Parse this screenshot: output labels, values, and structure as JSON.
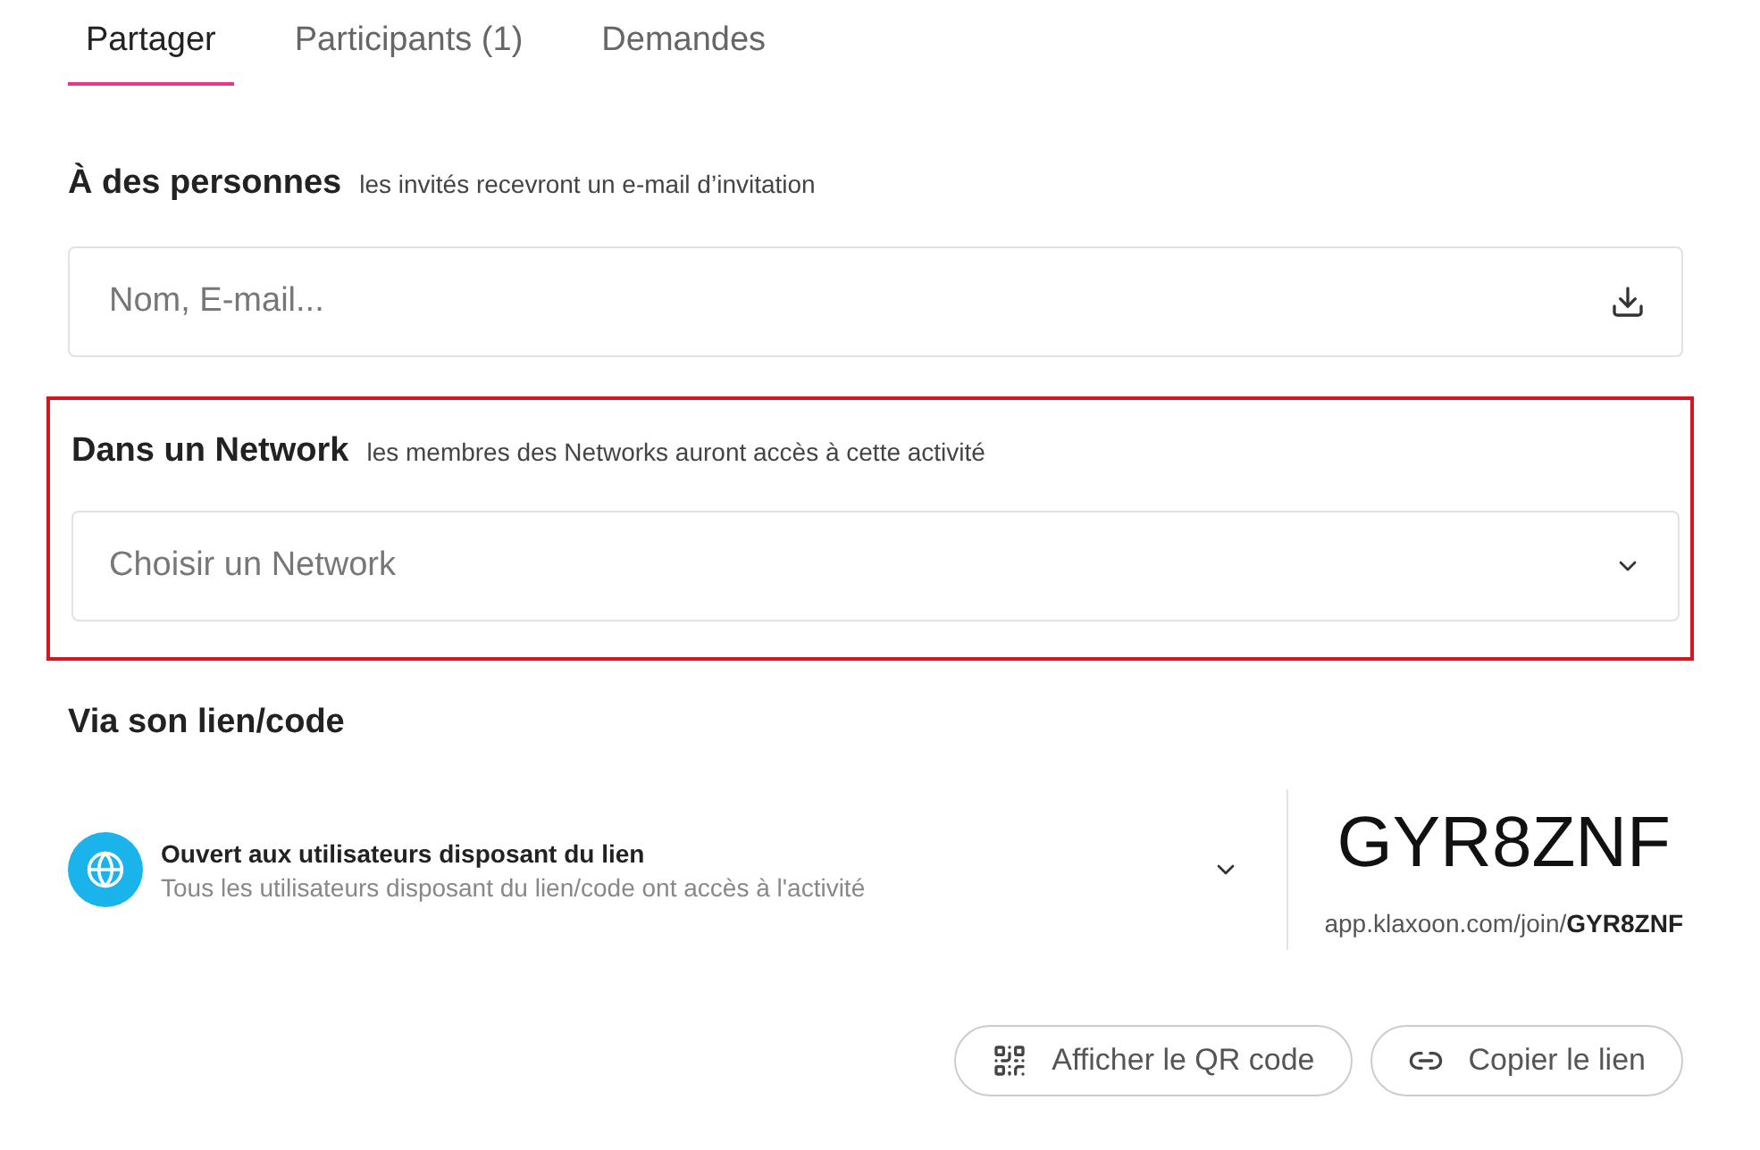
{
  "tabs": [
    {
      "label": "Partager",
      "selected": true
    },
    {
      "label": "Participants (1)",
      "selected": false
    },
    {
      "label": "Demandes",
      "selected": false
    }
  ],
  "people": {
    "title": "À des personnes",
    "hint": "les invités recevront un e-mail d’invitation",
    "placeholder": "Nom, E-mail..."
  },
  "network": {
    "title": "Dans un Network",
    "hint": "les membres des Networks auront accès à cette activité",
    "placeholder": "Choisir un Network",
    "highlighted": true
  },
  "link": {
    "title": "Via son lien/code",
    "access_title": "Ouvert aux utilisateurs disposant du lien",
    "access_description": "Tous les utilisateurs disposant du lien/code ont accès à l'activité",
    "code": "GYR8ZNF",
    "url": "app.klaxoon.com/join/**GYR8ZNF**"
  },
  "buttons": [
    {
      "kind": "qr",
      "label": "Afficher le QR code"
    },
    {
      "kind": "link",
      "label": "Copier le lien"
    }
  ]
}
